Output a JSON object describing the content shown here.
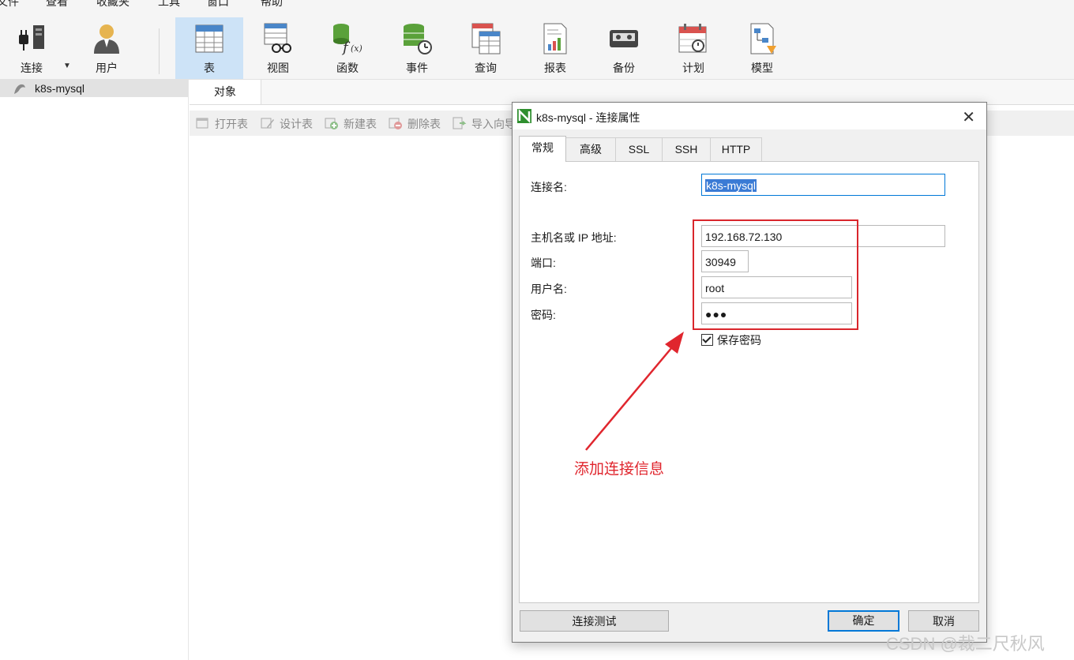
{
  "menu": [
    "文件",
    "查看",
    "收藏夹",
    "工具",
    "窗口",
    "帮助"
  ],
  "toolbar": {
    "connect_label": "连接",
    "user_label": "用户",
    "items": [
      "表",
      "视图",
      "函数",
      "事件",
      "查询",
      "报表",
      "备份",
      "计划",
      "模型"
    ],
    "active_item": "表"
  },
  "sidebar": {
    "items": [
      {
        "label": "k8s-mysql"
      }
    ]
  },
  "object_tab": "对象",
  "object_toolbar": [
    "打开表",
    "设计表",
    "新建表",
    "删除表",
    "导入向导"
  ],
  "dialog": {
    "title": "k8s-mysql - 连接属性",
    "close_glyph": "✕",
    "tabs": [
      "常规",
      "高级",
      "SSL",
      "SSH",
      "HTTP"
    ],
    "active_tab": "常规",
    "fields": {
      "connection_name": {
        "label": "连接名:",
        "value": "k8s-mysql"
      },
      "host": {
        "label": "主机名或 IP 地址:",
        "value": "192.168.72.130"
      },
      "port": {
        "label": "端口:",
        "value": "30949"
      },
      "username": {
        "label": "用户名:",
        "value": "root"
      },
      "password": {
        "label": "密码:",
        "value": "●●●"
      }
    },
    "save_password": {
      "label": "保存密码",
      "checked": true
    },
    "test_button": "连接测试",
    "ok_button": "确定",
    "cancel_button": "取消"
  },
  "annotation": {
    "text": "添加连接信息",
    "color": "#e0262e"
  },
  "watermark": "CSDN @裁二尺秋风",
  "colors": {
    "accent": "#0078d7",
    "active_toolbar_bg": "#cde3f7",
    "annotation_red": "#d9262c"
  }
}
